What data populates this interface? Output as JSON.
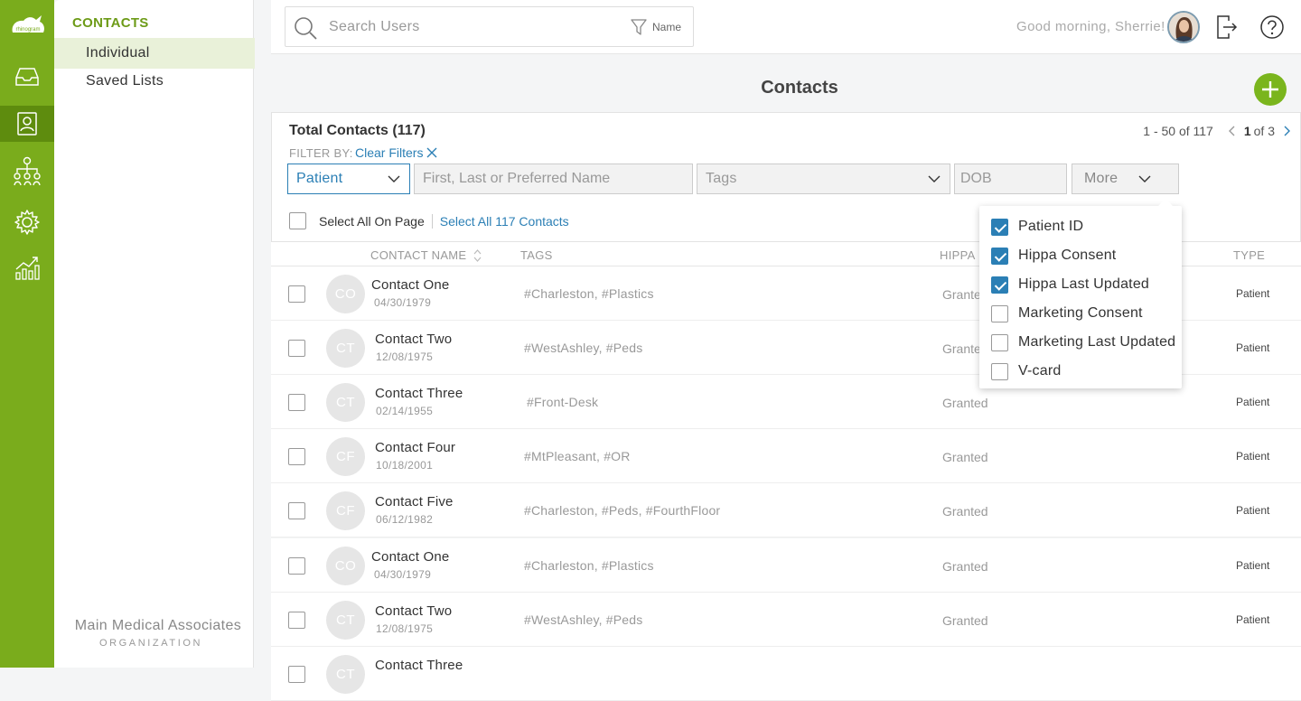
{
  "app": {
    "logo_text": "rhinogram",
    "brand_color": "#7aac1c",
    "accent_color": "#2b7fb5"
  },
  "rail": [
    {
      "icon": "inbox-icon"
    },
    {
      "icon": "contacts-icon",
      "active": true
    },
    {
      "icon": "org-chart-icon"
    },
    {
      "icon": "settings-icon"
    },
    {
      "icon": "analytics-icon"
    }
  ],
  "subnav": {
    "section_title": "CONTACTS",
    "items": [
      {
        "label": "Individual",
        "active": true
      },
      {
        "label": "Saved Lists"
      }
    ],
    "org_name": "Main Medical Associates",
    "org_label": "ORGANIZATION"
  },
  "header": {
    "search_placeholder": "Search Users",
    "filter_label": "Name",
    "greeting": "Good morning, Sherrie!"
  },
  "page": {
    "title": "Contacts",
    "total": "Total Contacts (117)",
    "filter_by": "FILTER BY:",
    "clear_filters": "Clear Filters",
    "pager": {
      "range": "1 - 50 of 117",
      "current": "1",
      "of": "of 3"
    },
    "filters": {
      "type_value": "Patient",
      "name_placeholder": "First, Last or Preferred Name",
      "tags_placeholder": "Tags",
      "dob_placeholder": "DOB",
      "more_label": "More"
    },
    "select_all_page": "Select All On Page",
    "select_all_contacts": "Select All 117 Contacts"
  },
  "table": {
    "headers": {
      "name": "CONTACT NAME",
      "tags": "TAGS",
      "hippa": "HIPPA",
      "type": "TYPE"
    },
    "rows": [
      {
        "initials": "CO",
        "name": "Contact One",
        "dob": "04/30/1979",
        "tags": "#Charleston, #Plastics",
        "hippa": "Granted",
        "type": "Patient"
      },
      {
        "initials": "CT",
        "name": "Contact Two",
        "dob": "12/08/1975",
        "tags": "#WestAshley, #Peds",
        "hippa": "Granted",
        "type": "Patient"
      },
      {
        "initials": "CT",
        "name": "Contact Three",
        "dob": "02/14/1955",
        "tags": "#Front-Desk",
        "hippa": "Granted",
        "type": "Patient"
      },
      {
        "initials": "CF",
        "name": "Contact Four",
        "dob": "10/18/2001",
        "tags": "#MtPleasant, #OR",
        "hippa": "Granted",
        "type": "Patient"
      },
      {
        "initials": "CF",
        "name": "Contact Five",
        "dob": "06/12/1982",
        "tags": "#Charleston, #Peds, #FourthFloor",
        "hippa": "Granted",
        "type": "Patient"
      },
      {
        "initials": "CO",
        "name": "Contact One",
        "dob": "04/30/1979",
        "tags": "#Charleston, #Plastics",
        "hippa": "Granted",
        "type": "Patient"
      },
      {
        "initials": "CT",
        "name": "Contact Two",
        "dob": "12/08/1975",
        "tags": "#WestAshley, #Peds",
        "hippa": "Granted",
        "type": "Patient"
      },
      {
        "initials": "CT",
        "name": "Contact Three",
        "dob": "",
        "tags": "",
        "hippa": "",
        "type": ""
      }
    ]
  },
  "more_menu": {
    "options": [
      {
        "label": "Patient ID",
        "checked": true
      },
      {
        "label": "Hippa Consent",
        "checked": true
      },
      {
        "label": "Hippa Last Updated",
        "checked": true
      },
      {
        "label": "Marketing Consent",
        "checked": false
      },
      {
        "label": "Marketing Last Updated",
        "checked": false
      },
      {
        "label": "V-card",
        "checked": false
      }
    ]
  }
}
